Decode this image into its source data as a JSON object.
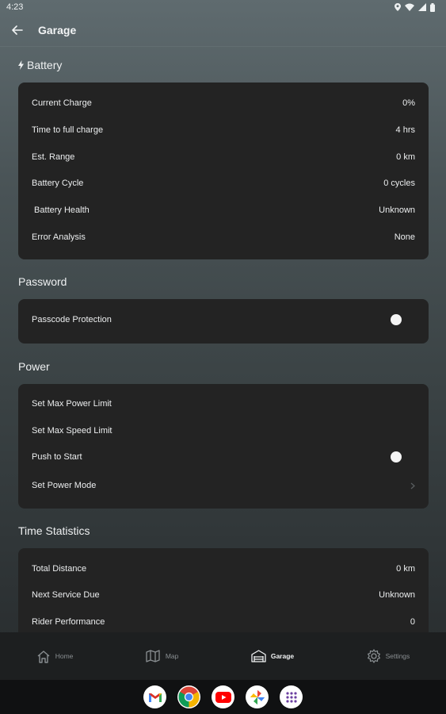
{
  "status_bar": {
    "time": "4:23"
  },
  "app_bar": {
    "title": "Garage"
  },
  "battery": {
    "title": "Battery",
    "rows": [
      {
        "label": "Current Charge",
        "value": "0%"
      },
      {
        "label": "Time to full charge",
        "value": "4 hrs"
      },
      {
        "label": "Est. Range",
        "value": "0 km"
      },
      {
        "label": "Battery Cycle",
        "value": "0 cycles"
      },
      {
        "label": " Battery Health",
        "value": "Unknown"
      },
      {
        "label": "Error Analysis",
        "value": "None"
      }
    ]
  },
  "password": {
    "title": "Password",
    "rows": [
      {
        "label": "Passcode Protection"
      }
    ]
  },
  "power": {
    "title": "Power",
    "rows": [
      {
        "label": "Set Max Power Limit"
      },
      {
        "label": "Set Max Speed Limit"
      },
      {
        "label": "Push to Start"
      },
      {
        "label": "Set Power Mode"
      }
    ]
  },
  "time_statistics": {
    "title": "Time Statistics",
    "rows": [
      {
        "label": "Total Distance",
        "value": "0 km"
      },
      {
        "label": "Next Service Due",
        "value": "Unknown"
      },
      {
        "label": "Rider Performance",
        "value": "0"
      }
    ]
  },
  "bottom_nav": {
    "items": [
      {
        "label": "Home",
        "icon": "home-icon"
      },
      {
        "label": "Map",
        "icon": "map-icon"
      },
      {
        "label": "Garage",
        "icon": "garage-icon"
      },
      {
        "label": "Settings",
        "icon": "gear-icon"
      }
    ],
    "active": "Garage"
  },
  "dock": {
    "apps": [
      "gmail-icon",
      "chrome-icon",
      "youtube-icon",
      "photos-icon",
      "app-drawer-icon"
    ]
  },
  "colors": {
    "card_bg": "#232323",
    "nav_bg": "#1d1f20",
    "active_text": "#f1f3f4",
    "inactive_text": "#8a8f92"
  }
}
